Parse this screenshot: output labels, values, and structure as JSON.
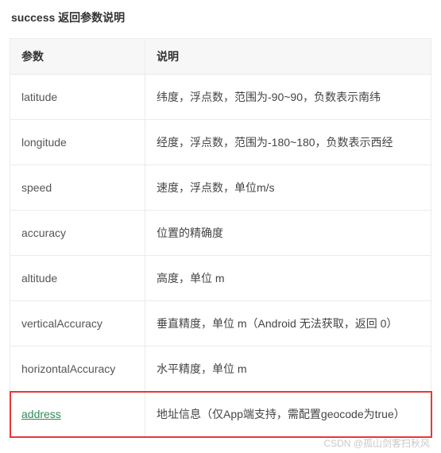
{
  "title": "success 返回参数说明",
  "headers": {
    "param": "参数",
    "desc": "说明"
  },
  "rows": [
    {
      "param": "latitude",
      "desc": "纬度，浮点数，范围为-90~90，负数表示南纬",
      "link": false
    },
    {
      "param": "longitude",
      "desc": "经度，浮点数，范围为-180~180，负数表示西经",
      "link": false
    },
    {
      "param": "speed",
      "desc": "速度，浮点数，单位m/s",
      "link": false
    },
    {
      "param": "accuracy",
      "desc": "位置的精确度",
      "link": false
    },
    {
      "param": "altitude",
      "desc": "高度，单位 m",
      "link": false
    },
    {
      "param": "verticalAccuracy",
      "desc": "垂直精度，单位 m（Android 无法获取，返回 0）",
      "link": false
    },
    {
      "param": "horizontalAccuracy",
      "desc": "水平精度，单位 m",
      "link": false
    },
    {
      "param": "address",
      "desc": "地址信息（仅App端支持，需配置geocode为true）",
      "link": true,
      "highlight": true
    }
  ],
  "watermark": "CSDN @孤山剑客扫秋风"
}
